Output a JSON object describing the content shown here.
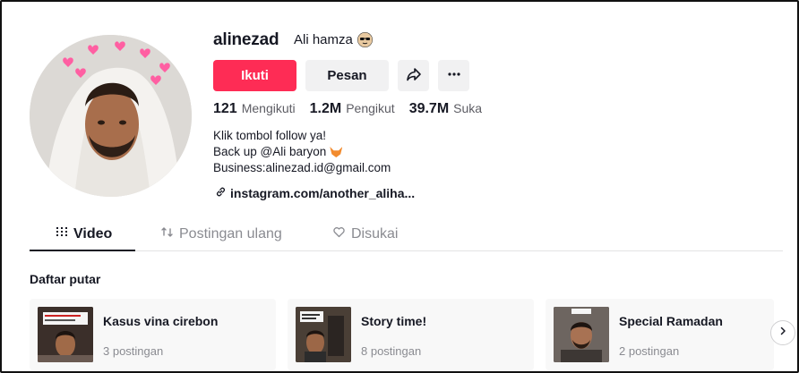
{
  "profile": {
    "username": "alinezad",
    "nickname": "Ali hamza",
    "nickname_icon": "sunglasses-emoji-icon",
    "follow_label": "Ikuti",
    "message_label": "Pesan",
    "share_icon": "share-icon",
    "more_icon": "more-icon",
    "stats": {
      "following_count": "121",
      "following_label": "Mengikuti",
      "followers_count": "1.2M",
      "followers_label": "Pengikut",
      "likes_count": "39.7M",
      "likes_label": "Suka"
    },
    "bio": {
      "line1": "Klik tombol follow ya!",
      "line2": "Back up @Ali baryon",
      "line2_icon": "fox-emoji-icon",
      "line3": "Business:alinezad.id@gmail.com"
    },
    "link_text": "instagram.com/another_aliha...",
    "colors": {
      "accent": "#fe2c55",
      "text": "#161823",
      "muted": "#8a8b91",
      "button_bg": "#f1f1f2"
    }
  },
  "tabs": [
    {
      "label": "Video",
      "icon": "grid-icon",
      "active": true
    },
    {
      "label": "Postingan ulang",
      "icon": "repost-icon",
      "active": false
    },
    {
      "label": "Disukai",
      "icon": "heart-outline-icon",
      "active": false
    }
  ],
  "playlists": {
    "title": "Daftar putar",
    "items": [
      {
        "name": "Kasus vina cirebon",
        "count": "3 postingan"
      },
      {
        "name": "Story time!",
        "count": "8 postingan"
      },
      {
        "name": "Special Ramadan",
        "count": "2 postingan"
      }
    ],
    "next_icon": "chevron-right-icon"
  }
}
